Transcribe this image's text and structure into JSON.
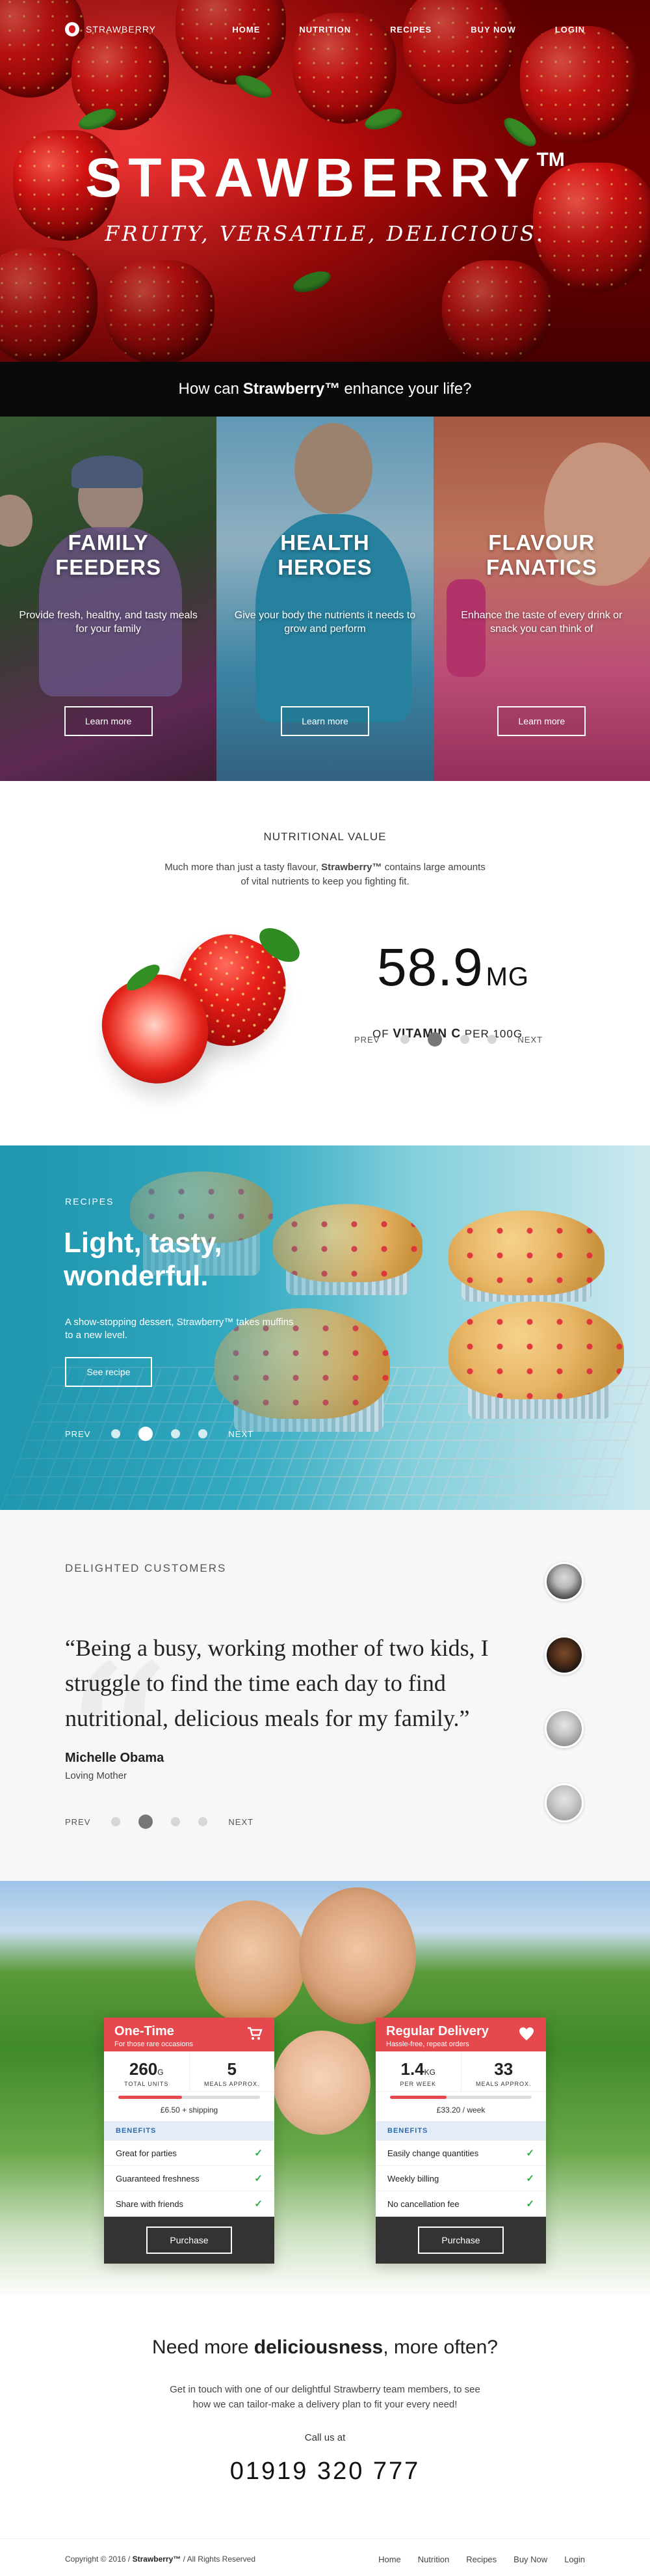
{
  "nav": {
    "logo": "STRAWBERRY",
    "links": [
      "HOME",
      "NUTRITION",
      "RECIPES",
      "BUY NOW",
      "LOGIN"
    ]
  },
  "hero": {
    "title": "STRAWBERRY",
    "tm": "TM",
    "subtitle": "FRUITY, VERSATILE, DELICIOUS.",
    "question_pre": "How can",
    "question_brand": "Strawberry™",
    "question_post": "enhance your life?"
  },
  "panels": [
    {
      "title": "FAMILY\nFEEDERS",
      "desc": "Provide fresh, healthy, and tasty meals for your family",
      "button": "Learn more"
    },
    {
      "title": "HEALTH\nHEROES",
      "desc": "Give your body the nutrients it needs to grow and perform",
      "button": "Learn more"
    },
    {
      "title": "FLAVOUR\nFANATICS",
      "desc": "Enhance the taste of every drink or snack you can think of",
      "button": "Learn more"
    }
  ],
  "nutrition": {
    "heading": "NUTRITIONAL VALUE",
    "desc_pre": "Much more than just a tasty flavour,",
    "desc_brand": "Strawberry™",
    "desc_post": "contains large amounts of vital nutrients to keep you fighting fit.",
    "value": "58.9",
    "unit": "MG",
    "label_pre": "OF",
    "label_nutrient": "VITAMIN C",
    "label_post": "PER 100G",
    "prev": "PREV",
    "next": "NEXT",
    "active_index": 1,
    "dot_count": 4
  },
  "recipes": {
    "kicker": "RECIPES",
    "title": "Light, tasty, wonderful.",
    "desc": "A show-stopping dessert, Strawberry™ takes muffins to a new level.",
    "button": "See recipe",
    "prev": "PREV",
    "next": "NEXT",
    "active_index": 1,
    "dot_count": 4
  },
  "testimonial": {
    "kicker": "DELIGHTED CUSTOMERS",
    "quote": "“Being a busy, working mother of two kids, I struggle to find the time each day to find nutritional, delicious meals for my family.”",
    "name": "Michelle Obama",
    "role": "Loving Mother",
    "prev": "PREV",
    "next": "NEXT",
    "active_index": 1,
    "dot_count": 4
  },
  "pricing": {
    "cards": [
      {
        "title": "One-Time",
        "subtitle": "For those rare occasions",
        "icon": "cart-icon",
        "stat1_value": "260",
        "stat1_unit": "G",
        "stat1_label": "TOTAL UNITS",
        "stat2_value": "5",
        "stat2_label": "MEALS APPROX.",
        "progress": 0.45,
        "price": "£6.50 + shipping",
        "benefits_label": "BENEFITS",
        "benefits": [
          "Great for parties",
          "Guaranteed freshness",
          "Share with friends"
        ],
        "button": "Purchase"
      },
      {
        "title": "Regular Delivery",
        "subtitle": "Hassle-free, repeat orders",
        "icon": "heart-icon",
        "stat1_value": "1.4",
        "stat1_unit": "KG",
        "stat1_label": "PER WEEK",
        "stat2_value": "33",
        "stat2_label": "MEALS APPROX.",
        "progress": 0.4,
        "price": "£33.20 / week",
        "benefits_label": "BENEFITS",
        "benefits": [
          "Easily change quantities",
          "Weekly billing",
          "No cancellation fee"
        ],
        "button": "Purchase"
      }
    ]
  },
  "contact": {
    "title_pre": "Need more",
    "title_bold": "deliciousness",
    "title_post": ", more often?",
    "desc": "Get in touch with one of our delightful Strawberry team members, to see how we can tailor-make a delivery plan to fit your every need!",
    "call": "Call us at",
    "phone": "01919 320 777"
  },
  "footer": {
    "copyright_pre": "Copyright © 2016 /",
    "copyright_brand": "Strawberry™",
    "copyright_post": "/ All Rights Reserved",
    "links": [
      "Home",
      "Nutrition",
      "Recipes",
      "Buy Now",
      "Login"
    ]
  },
  "colors": {
    "accent": "#e5484d",
    "check": "#2faa4a",
    "benefits_bg": "#e3ecf7",
    "dark": "#333333"
  }
}
